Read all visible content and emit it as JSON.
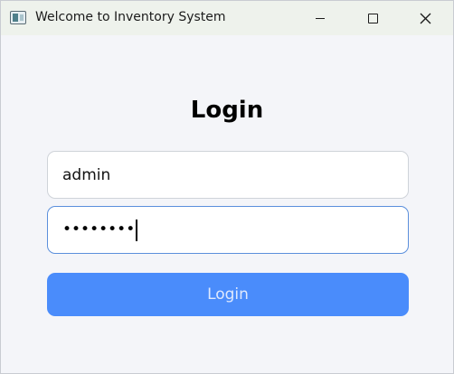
{
  "window": {
    "title": "Welcome to Inventory System",
    "icon": "app-window-icon",
    "controls": [
      "minimize-icon",
      "maximize-icon",
      "close-icon"
    ]
  },
  "form": {
    "heading": "Login",
    "username_value": "admin",
    "password_mask": "••••••••",
    "login_label": "Login"
  },
  "colors": {
    "accent": "#4a8cfb",
    "focus_border": "#5b8fdc",
    "background": "#f4f5f9"
  }
}
